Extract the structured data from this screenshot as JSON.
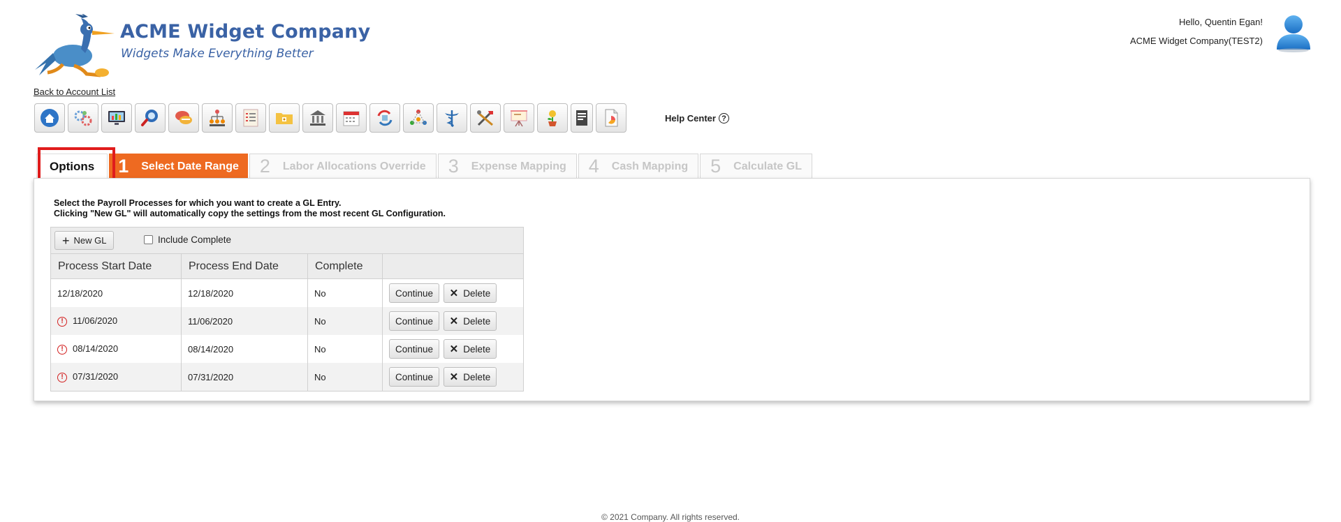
{
  "brand": {
    "name": "ACME Widget Company",
    "tagline": "Widgets Make Everything Better"
  },
  "user": {
    "greeting": "Hello, Quentin Egan!",
    "company": "ACME Widget Company(TEST2)"
  },
  "nav": {
    "back_link": "Back to Account List",
    "help_center": "Help Center",
    "help_glyph": "?"
  },
  "toolbar": {
    "icons": [
      "home-icon",
      "gears-icon",
      "monitor-chart-icon",
      "search-icon",
      "chat-icon",
      "org-chart-icon",
      "list-icon",
      "folder-icon",
      "bank-icon",
      "calendar-icon",
      "transfer-icon",
      "network-icon",
      "caduceus-icon",
      "tools-icon",
      "presentation-icon",
      "plant-icon",
      "document-icon",
      "report-icon"
    ]
  },
  "tabs": {
    "options": "Options",
    "steps": [
      {
        "num": "1",
        "label": "Select Date Range",
        "active": true
      },
      {
        "num": "2",
        "label": "Labor Allocations Override",
        "active": false
      },
      {
        "num": "3",
        "label": "Expense Mapping",
        "active": false
      },
      {
        "num": "4",
        "label": "Cash Mapping",
        "active": false
      },
      {
        "num": "5",
        "label": "Calculate GL",
        "active": false
      }
    ]
  },
  "main": {
    "instruction_line1": "Select the Payroll Processes for which you want to create a GL Entry.",
    "instruction_line2": "Clicking \"New GL\" will automatically copy the settings from the most recent GL Configuration.",
    "new_gl_label": "New GL",
    "include_complete_label": "Include Complete",
    "include_complete_checked": false,
    "columns": [
      "Process Start Date",
      "Process End Date",
      "Complete",
      ""
    ],
    "rows": [
      {
        "start": "12/18/2020",
        "end": "12/18/2020",
        "complete": "No",
        "warning": false
      },
      {
        "start": "11/06/2020",
        "end": "11/06/2020",
        "complete": "No",
        "warning": true
      },
      {
        "start": "08/14/2020",
        "end": "08/14/2020",
        "complete": "No",
        "warning": true
      },
      {
        "start": "07/31/2020",
        "end": "07/31/2020",
        "complete": "No",
        "warning": true
      }
    ],
    "continue_label": "Continue",
    "delete_label": "Delete"
  },
  "colors": {
    "brand_blue": "#3a62a5",
    "active_tab": "#ee6a21",
    "highlight": "#e01c1c",
    "warning": "#d32020"
  },
  "footer": {
    "text": "© 2021 Company. All rights reserved."
  }
}
